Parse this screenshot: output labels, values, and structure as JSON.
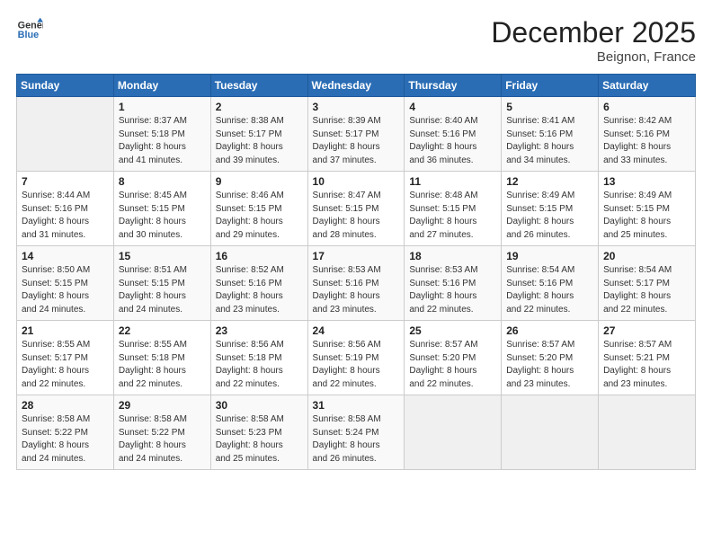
{
  "header": {
    "logo_line1": "General",
    "logo_line2": "Blue",
    "month_year": "December 2025",
    "location": "Beignon, France"
  },
  "days_of_week": [
    "Sunday",
    "Monday",
    "Tuesday",
    "Wednesday",
    "Thursday",
    "Friday",
    "Saturday"
  ],
  "weeks": [
    [
      {
        "day": "",
        "info": ""
      },
      {
        "day": "1",
        "info": "Sunrise: 8:37 AM\nSunset: 5:18 PM\nDaylight: 8 hours\nand 41 minutes."
      },
      {
        "day": "2",
        "info": "Sunrise: 8:38 AM\nSunset: 5:17 PM\nDaylight: 8 hours\nand 39 minutes."
      },
      {
        "day": "3",
        "info": "Sunrise: 8:39 AM\nSunset: 5:17 PM\nDaylight: 8 hours\nand 37 minutes."
      },
      {
        "day": "4",
        "info": "Sunrise: 8:40 AM\nSunset: 5:16 PM\nDaylight: 8 hours\nand 36 minutes."
      },
      {
        "day": "5",
        "info": "Sunrise: 8:41 AM\nSunset: 5:16 PM\nDaylight: 8 hours\nand 34 minutes."
      },
      {
        "day": "6",
        "info": "Sunrise: 8:42 AM\nSunset: 5:16 PM\nDaylight: 8 hours\nand 33 minutes."
      }
    ],
    [
      {
        "day": "7",
        "info": "Sunrise: 8:44 AM\nSunset: 5:16 PM\nDaylight: 8 hours\nand 31 minutes."
      },
      {
        "day": "8",
        "info": "Sunrise: 8:45 AM\nSunset: 5:15 PM\nDaylight: 8 hours\nand 30 minutes."
      },
      {
        "day": "9",
        "info": "Sunrise: 8:46 AM\nSunset: 5:15 PM\nDaylight: 8 hours\nand 29 minutes."
      },
      {
        "day": "10",
        "info": "Sunrise: 8:47 AM\nSunset: 5:15 PM\nDaylight: 8 hours\nand 28 minutes."
      },
      {
        "day": "11",
        "info": "Sunrise: 8:48 AM\nSunset: 5:15 PM\nDaylight: 8 hours\nand 27 minutes."
      },
      {
        "day": "12",
        "info": "Sunrise: 8:49 AM\nSunset: 5:15 PM\nDaylight: 8 hours\nand 26 minutes."
      },
      {
        "day": "13",
        "info": "Sunrise: 8:49 AM\nSunset: 5:15 PM\nDaylight: 8 hours\nand 25 minutes."
      }
    ],
    [
      {
        "day": "14",
        "info": "Sunrise: 8:50 AM\nSunset: 5:15 PM\nDaylight: 8 hours\nand 24 minutes."
      },
      {
        "day": "15",
        "info": "Sunrise: 8:51 AM\nSunset: 5:15 PM\nDaylight: 8 hours\nand 24 minutes."
      },
      {
        "day": "16",
        "info": "Sunrise: 8:52 AM\nSunset: 5:16 PM\nDaylight: 8 hours\nand 23 minutes."
      },
      {
        "day": "17",
        "info": "Sunrise: 8:53 AM\nSunset: 5:16 PM\nDaylight: 8 hours\nand 23 minutes."
      },
      {
        "day": "18",
        "info": "Sunrise: 8:53 AM\nSunset: 5:16 PM\nDaylight: 8 hours\nand 22 minutes."
      },
      {
        "day": "19",
        "info": "Sunrise: 8:54 AM\nSunset: 5:16 PM\nDaylight: 8 hours\nand 22 minutes."
      },
      {
        "day": "20",
        "info": "Sunrise: 8:54 AM\nSunset: 5:17 PM\nDaylight: 8 hours\nand 22 minutes."
      }
    ],
    [
      {
        "day": "21",
        "info": "Sunrise: 8:55 AM\nSunset: 5:17 PM\nDaylight: 8 hours\nand 22 minutes."
      },
      {
        "day": "22",
        "info": "Sunrise: 8:55 AM\nSunset: 5:18 PM\nDaylight: 8 hours\nand 22 minutes."
      },
      {
        "day": "23",
        "info": "Sunrise: 8:56 AM\nSunset: 5:18 PM\nDaylight: 8 hours\nand 22 minutes."
      },
      {
        "day": "24",
        "info": "Sunrise: 8:56 AM\nSunset: 5:19 PM\nDaylight: 8 hours\nand 22 minutes."
      },
      {
        "day": "25",
        "info": "Sunrise: 8:57 AM\nSunset: 5:20 PM\nDaylight: 8 hours\nand 22 minutes."
      },
      {
        "day": "26",
        "info": "Sunrise: 8:57 AM\nSunset: 5:20 PM\nDaylight: 8 hours\nand 23 minutes."
      },
      {
        "day": "27",
        "info": "Sunrise: 8:57 AM\nSunset: 5:21 PM\nDaylight: 8 hours\nand 23 minutes."
      }
    ],
    [
      {
        "day": "28",
        "info": "Sunrise: 8:58 AM\nSunset: 5:22 PM\nDaylight: 8 hours\nand 24 minutes."
      },
      {
        "day": "29",
        "info": "Sunrise: 8:58 AM\nSunset: 5:22 PM\nDaylight: 8 hours\nand 24 minutes."
      },
      {
        "day": "30",
        "info": "Sunrise: 8:58 AM\nSunset: 5:23 PM\nDaylight: 8 hours\nand 25 minutes."
      },
      {
        "day": "31",
        "info": "Sunrise: 8:58 AM\nSunset: 5:24 PM\nDaylight: 8 hours\nand 26 minutes."
      },
      {
        "day": "",
        "info": ""
      },
      {
        "day": "",
        "info": ""
      },
      {
        "day": "",
        "info": ""
      }
    ]
  ]
}
